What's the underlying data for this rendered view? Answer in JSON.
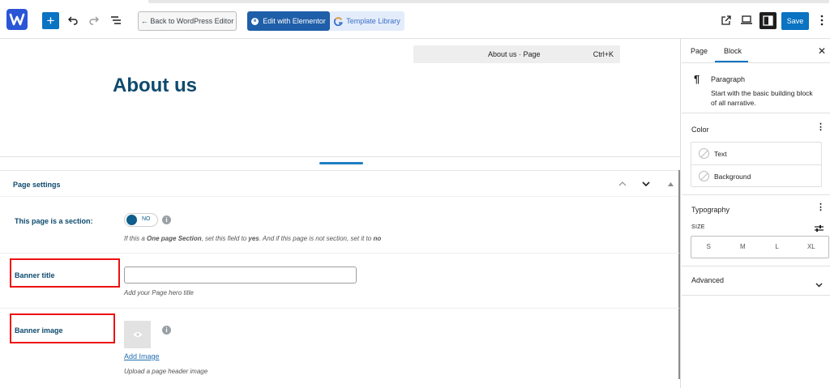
{
  "toolbar": {
    "back_label": "← Back to WordPress Editor",
    "elementor_label": "Edit with Elementor",
    "template_label": "Template Library",
    "save_label": "Save",
    "add_label": "+"
  },
  "command_bar": {
    "title": "About us · Page",
    "shortcut": "Ctrl+K"
  },
  "editor": {
    "page_title": "About us"
  },
  "page_settings": {
    "title": "Page settings",
    "section_label": "This page is a section:",
    "toggle_text": "NO",
    "section_hint_parts": [
      "If this a ",
      "One page Section",
      ", set this field to ",
      "yes",
      ". And if this page is not section, set it to ",
      "no"
    ],
    "banner_title_label": "Banner title",
    "banner_title_value": "",
    "banner_title_hint": "Add your Page hero title",
    "banner_image_label": "Banner image",
    "add_image_label": "Add Image",
    "banner_image_hint": "Upload a page header image"
  },
  "sidebar": {
    "tabs": [
      "Page",
      "Block"
    ],
    "active_tab": "Block",
    "block_name": "Paragraph",
    "block_description": "Start with the basic building block of all narrative.",
    "color_title": "Color",
    "color_items": [
      "Text",
      "Background"
    ],
    "typography_title": "Typography",
    "size_label": "SIZE",
    "sizes": [
      "S",
      "M",
      "L",
      "XL"
    ],
    "advanced_title": "Advanced"
  },
  "colors": {
    "accent": "#0a73c2",
    "heading": "#0d4a6e",
    "highlight_box": "#e11111"
  }
}
